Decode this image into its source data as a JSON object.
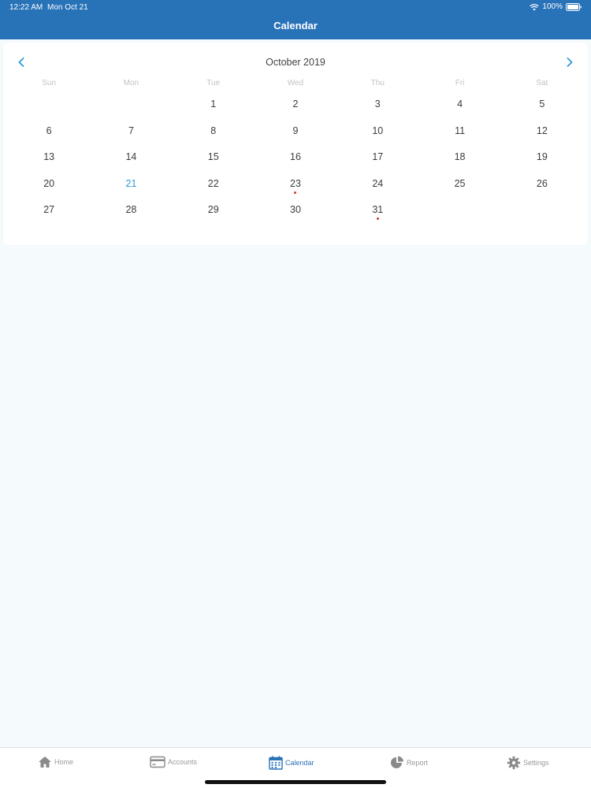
{
  "status_bar": {
    "time": "12:22 AM",
    "date": "Mon Oct 21",
    "battery": "100%"
  },
  "nav": {
    "title": "Calendar"
  },
  "calendar": {
    "month_label": "October 2019",
    "weekdays": [
      "Sun",
      "Mon",
      "Tue",
      "Wed",
      "Thu",
      "Fri",
      "Sat"
    ],
    "first_weekday_index": 2,
    "days": [
      "1",
      "2",
      "3",
      "4",
      "5",
      "6",
      "7",
      "8",
      "9",
      "10",
      "11",
      "12",
      "13",
      "14",
      "15",
      "16",
      "17",
      "18",
      "19",
      "20",
      "21",
      "22",
      "23",
      "24",
      "25",
      "26",
      "27",
      "28",
      "29",
      "30",
      "31"
    ],
    "today": "21",
    "event_days": [
      "23",
      "31"
    ],
    "colors": {
      "accent": "#2e9ad8",
      "event_dot": "#d33a2c",
      "header": "#2872b8"
    }
  },
  "tabbar": {
    "tabs": [
      {
        "label": "Home",
        "icon": "home-icon"
      },
      {
        "label": "Accounts",
        "icon": "credit-card-icon"
      },
      {
        "label": "Calendar",
        "icon": "calendar-icon",
        "active": true
      },
      {
        "label": "Report",
        "icon": "pie-chart-icon"
      },
      {
        "label": "Settings",
        "icon": "gear-icon"
      }
    ]
  }
}
